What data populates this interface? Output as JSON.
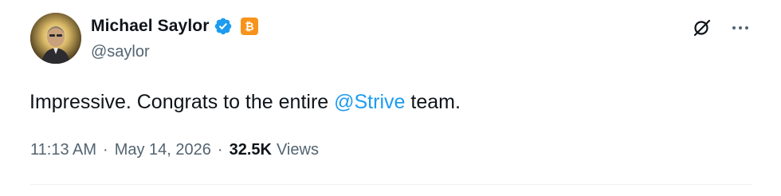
{
  "post": {
    "author": {
      "display_name": "Michael Saylor",
      "handle": "@saylor",
      "verified_icon": "verified-badge-icon",
      "affiliate_icon": "bitcoin-icon"
    },
    "text_before": "Impressive. Congrats to the entire ",
    "mention": "@Strive",
    "text_after": " team.",
    "time": "11:13 AM",
    "separator": "·",
    "date": "May 14, 2026",
    "views_count": "32.5K",
    "views_label": "Views",
    "actions": {
      "grok_icon": "grok-icon",
      "more_icon": "more-options-icon"
    }
  },
  "colors": {
    "text_primary": "#0f1419",
    "text_secondary": "#536471",
    "link": "#1d9bf0",
    "verified": "#1d9bf0",
    "bitcoin": "#f7931a"
  }
}
